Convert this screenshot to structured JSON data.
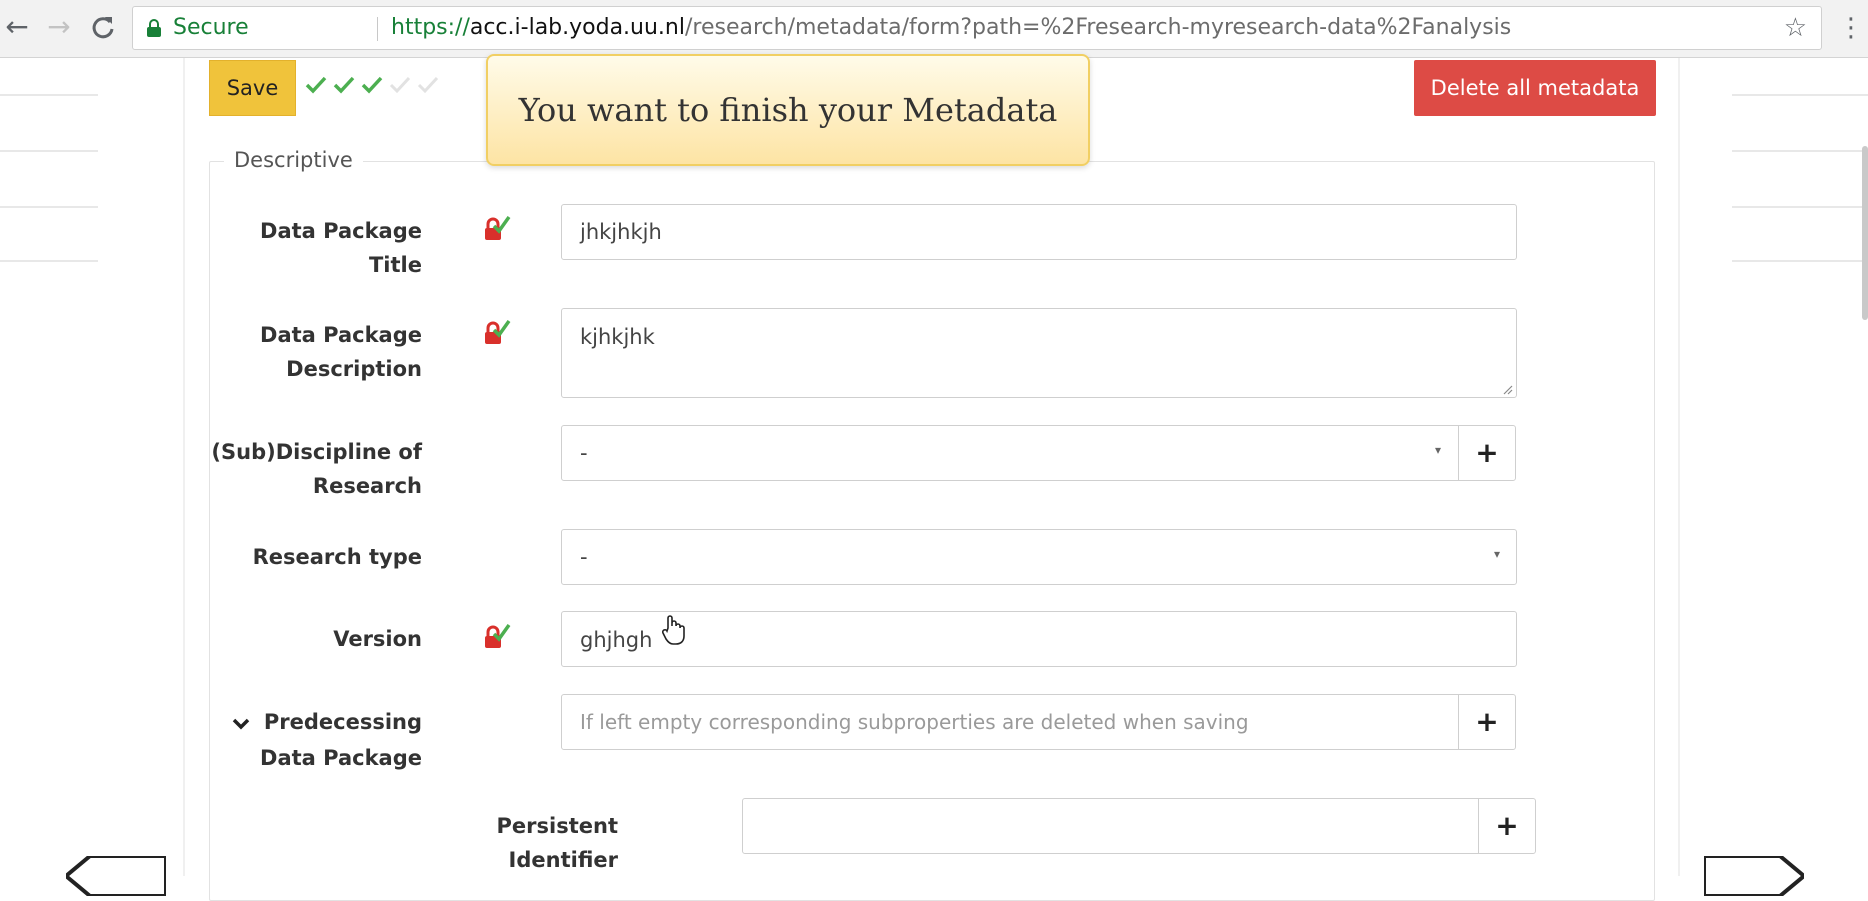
{
  "browser": {
    "secure_label": "Secure",
    "url_scheme": "https://",
    "url_host": "acc.i-lab.yoda.uu.nl",
    "url_path": "/research/metadata/form?path=%2Fresearch-myresearch-data%2Fanalysis",
    "back_glyph": "←",
    "forward_glyph": "→",
    "reload_glyph": "C",
    "star_glyph": "☆",
    "menu_glyph": "⋮"
  },
  "toolbar": {
    "save_label": "Save",
    "delete_label": "Delete all metadata",
    "progress_total": 5,
    "progress_completed": 3
  },
  "toast": {
    "message": "You want to finish your Metadata"
  },
  "section": {
    "legend": "Descriptive"
  },
  "fields": {
    "title": {
      "label_line1": "Data Package",
      "label_line2": "Title",
      "value": "jhkjhkjh"
    },
    "description": {
      "label_line1": "Data Package",
      "label_line2": "Description",
      "value": "kjhkjhk"
    },
    "discipline": {
      "label_line1": "(Sub)Discipline of",
      "label_line2": "Research",
      "value": "-"
    },
    "research_type": {
      "label": "Research type",
      "value": "-"
    },
    "version": {
      "label": "Version",
      "value": "ghjhgh"
    },
    "predecessing": {
      "label_line1": "Predecessing",
      "label_line2": "Data Package",
      "placeholder": "If left empty corresponding subproperties are deleted when saving"
    },
    "persistent_identifier": {
      "label_line1": "Persistent",
      "label_line2": "Identifier",
      "value": ""
    }
  },
  "buttons": {
    "plus_glyph": "+"
  },
  "icons": {
    "chevron": "chevron-down-icon",
    "lock_check": "lock-check-icon",
    "caret": "▾"
  },
  "colors": {
    "save_yellow": "#f0c33b",
    "delete_red": "#dd4b45",
    "check_green": "#4caf50",
    "lock_red": "#d9302b",
    "secure_green": "#188038"
  }
}
